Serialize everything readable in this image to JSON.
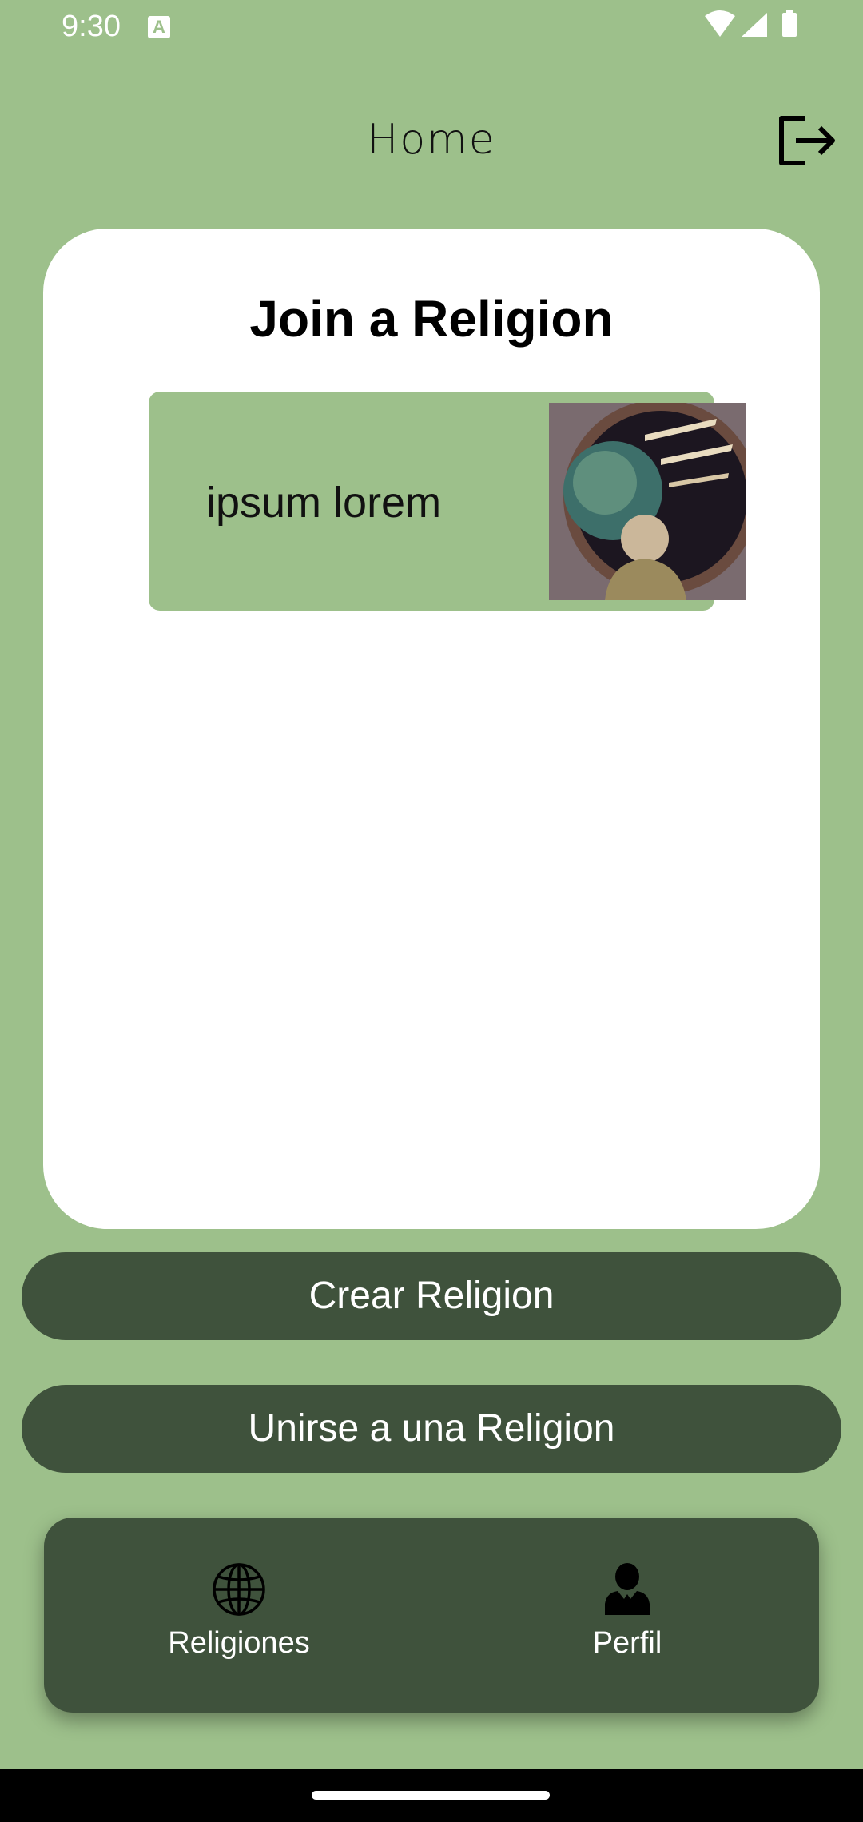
{
  "status_bar": {
    "time": "9:30",
    "notification_icon": "text-recognition-icon",
    "notification_glyph": "A",
    "right_icons": [
      "wifi-icon",
      "cell-signal-icon",
      "battery-icon"
    ]
  },
  "header": {
    "title": "Home",
    "logout_icon": "logout-icon"
  },
  "card": {
    "title": "Join a Religion",
    "items": [
      {
        "label": "ipsum lorem",
        "thumbnail_icon": "religion-thumbnail-image"
      }
    ]
  },
  "actions": {
    "create_label": "Crear Religion",
    "join_label": "Unirse a una Religion"
  },
  "bottom_nav": {
    "items": [
      {
        "label": "Religiones",
        "icon": "globe-icon"
      },
      {
        "label": "Perfil",
        "icon": "user-icon"
      }
    ]
  },
  "colors": {
    "background": "#9dc08b",
    "dark_green": "#3f523c",
    "card": "#ffffff",
    "text_dark": "#111111"
  }
}
